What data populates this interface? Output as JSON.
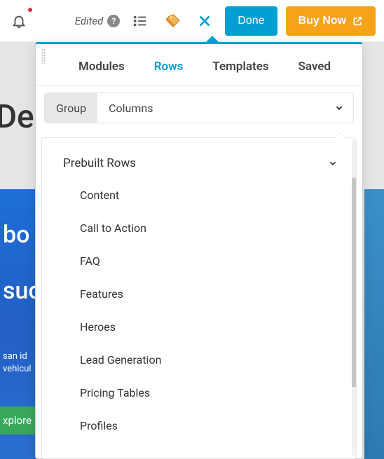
{
  "toolbar": {
    "edited_label": "Edited",
    "done_label": "Done",
    "buy_label": "Buy Now"
  },
  "background": {
    "heading": "Der",
    "hero1": "bo",
    "hero2": "suc",
    "paragraph": "san id\nvehicul",
    "explore": "xplore"
  },
  "panel": {
    "tabs": [
      {
        "label": "Modules",
        "active": false
      },
      {
        "label": "Rows",
        "active": true
      },
      {
        "label": "Templates",
        "active": false
      },
      {
        "label": "Saved",
        "active": false
      }
    ],
    "subtabs": [
      {
        "label": "Group",
        "selected": true
      },
      {
        "label": "Columns",
        "selected": false
      }
    ],
    "section_title": "Prebuilt Rows",
    "items": [
      "Content",
      "Call to Action",
      "FAQ",
      "Features",
      "Heroes",
      "Lead Generation",
      "Pricing Tables",
      "Profiles"
    ]
  }
}
